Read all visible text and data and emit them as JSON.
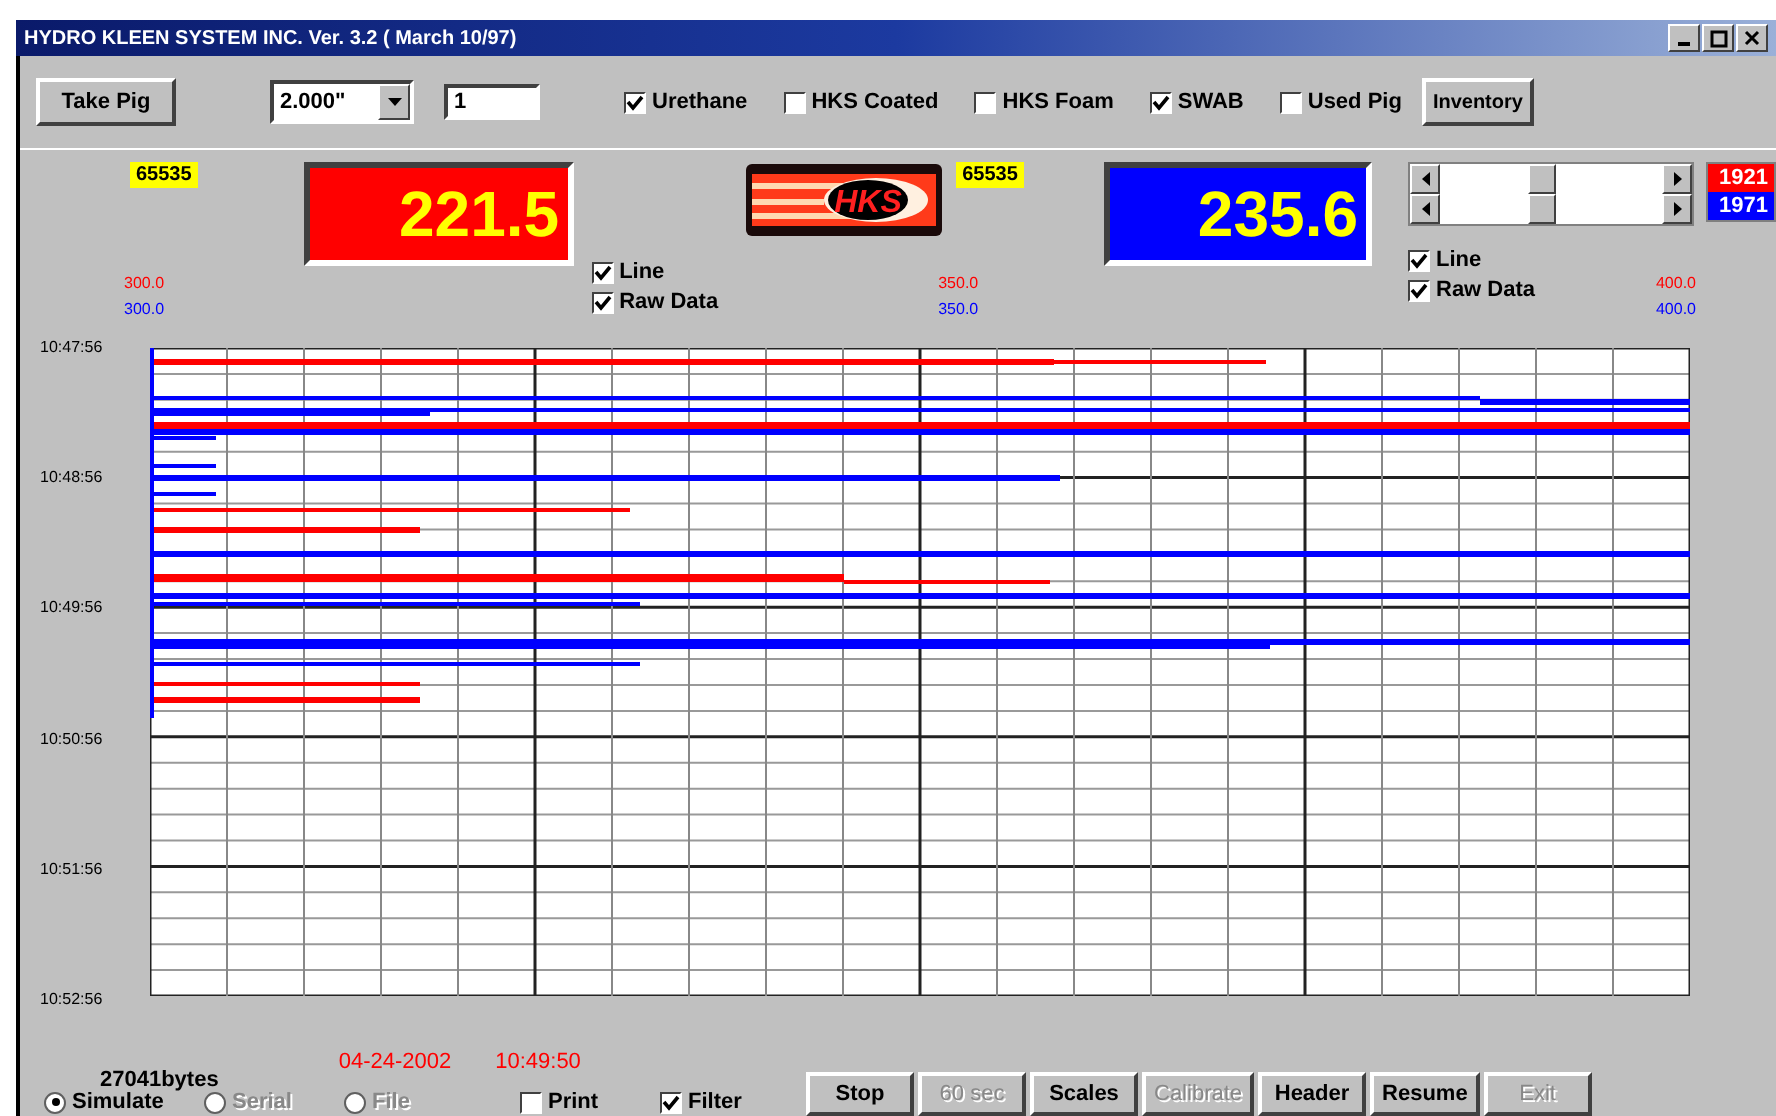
{
  "window": {
    "title": "HYDRO KLEEN SYSTEM INC. Ver. 3.2 ( March 10/97)"
  },
  "toolbar": {
    "take_pig": "Take Pig",
    "size": "2.000\"",
    "count": "1",
    "inventory": "Inventory",
    "options": [
      {
        "label": "Urethane",
        "checked": true
      },
      {
        "label": "HKS Coated",
        "checked": false
      },
      {
        "label": "HKS Foam",
        "checked": false
      },
      {
        "label": "SWAB",
        "checked": true
      },
      {
        "label": "Used Pig",
        "checked": false
      }
    ]
  },
  "counters": [
    "65535",
    "65535"
  ],
  "logo": {
    "text": "HKS"
  },
  "displays": [
    {
      "value": "221.5",
      "color": "#ff0000"
    },
    {
      "value": "235.6",
      "color": "#0000ff"
    }
  ],
  "scales": [
    {
      "red": "300.0",
      "blue": "300.0"
    },
    {
      "red": "350.0",
      "blue": "350.0"
    },
    {
      "red": "400.0",
      "blue": "400.0"
    }
  ],
  "display_options": [
    [
      {
        "label": "Line",
        "checked": true
      },
      {
        "label": "Raw Data",
        "checked": true
      }
    ],
    [
      {
        "label": "Line",
        "checked": true
      },
      {
        "label": "Raw Data",
        "checked": true
      }
    ]
  ],
  "sliders": [
    {
      "level": 0.45
    },
    {
      "level": 0.45
    }
  ],
  "legend": [
    {
      "label": "1921",
      "color": "#ff0000"
    },
    {
      "label": "1971",
      "color": "#0000ff"
    }
  ],
  "chart": {
    "time_labels": [
      "10:47:56",
      "10:48:56",
      "10:49:56",
      "10:50:56",
      "10:51:56",
      "10:52:56"
    ]
  },
  "status": {
    "bytes": "27041bytes",
    "date": "04-24-2002",
    "time": "10:49:50"
  },
  "sources": [
    {
      "label": "Simulate",
      "selected": true,
      "disabled": false
    },
    {
      "label": "Serial",
      "selected": false,
      "disabled": true
    },
    {
      "label": "File",
      "selected": false,
      "disabled": true
    }
  ],
  "checks": [
    {
      "label": "Print",
      "checked": false
    },
    {
      "label": "Filter",
      "checked": true
    }
  ],
  "buttons": [
    {
      "label": "Stop",
      "disabled": false
    },
    {
      "label": "60 sec",
      "disabled": true
    },
    {
      "label": "Scales",
      "disabled": false
    },
    {
      "label": "Calibrate",
      "disabled": true
    },
    {
      "label": "Header",
      "disabled": false
    },
    {
      "label": "Resume",
      "disabled": false
    },
    {
      "label": "Exit",
      "disabled": true
    }
  ]
}
